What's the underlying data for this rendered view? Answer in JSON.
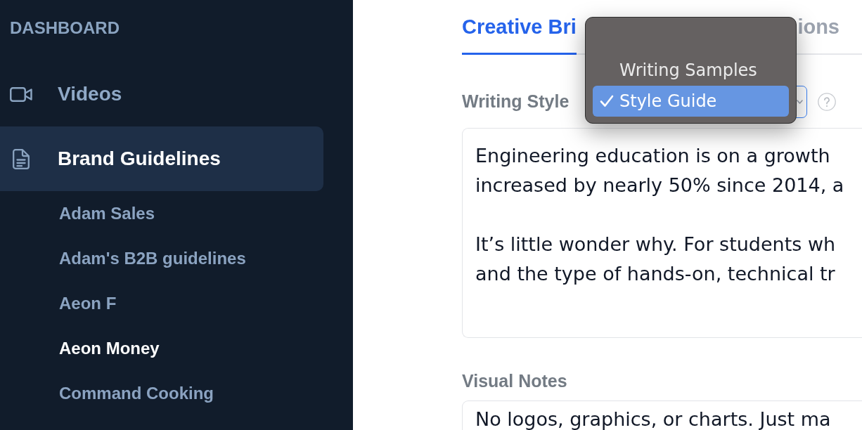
{
  "sidebar": {
    "heading": "DASHBOARD",
    "items": [
      {
        "kind": "video",
        "label": "Videos",
        "selected": false
      },
      {
        "kind": "document",
        "label": "Brand Guidelines",
        "selected": true,
        "children": [
          {
            "label": "Adam Sales",
            "selected": false
          },
          {
            "label": "Adam's B2B guidelines",
            "selected": false
          },
          {
            "label": "Aeon F",
            "selected": false
          },
          {
            "label": "Aeon Money",
            "selected": true
          },
          {
            "label": "Command Cooking",
            "selected": false
          }
        ]
      }
    ]
  },
  "tabs": [
    {
      "label": "Creative Bri",
      "selected": true
    },
    {
      "label": "ions",
      "selected": false
    }
  ],
  "writing_style": {
    "label": "Writing Style",
    "select": {
      "open": true,
      "options": [
        {
          "label": "Writing Samples",
          "selected": false
        },
        {
          "label": "Style Guide",
          "selected": true
        }
      ]
    },
    "text": [
      [
        "Engineering education is on a growth",
        "increased by nearly 50% since 2014, a"
      ],
      [
        "It’s little wonder why. For students wh",
        "and the type of hands-on, technical tr"
      ]
    ]
  },
  "visual_notes": {
    "label": "Visual Notes",
    "text": [
      [
        "No logos, graphics, or charts. Just ma"
      ]
    ]
  }
}
